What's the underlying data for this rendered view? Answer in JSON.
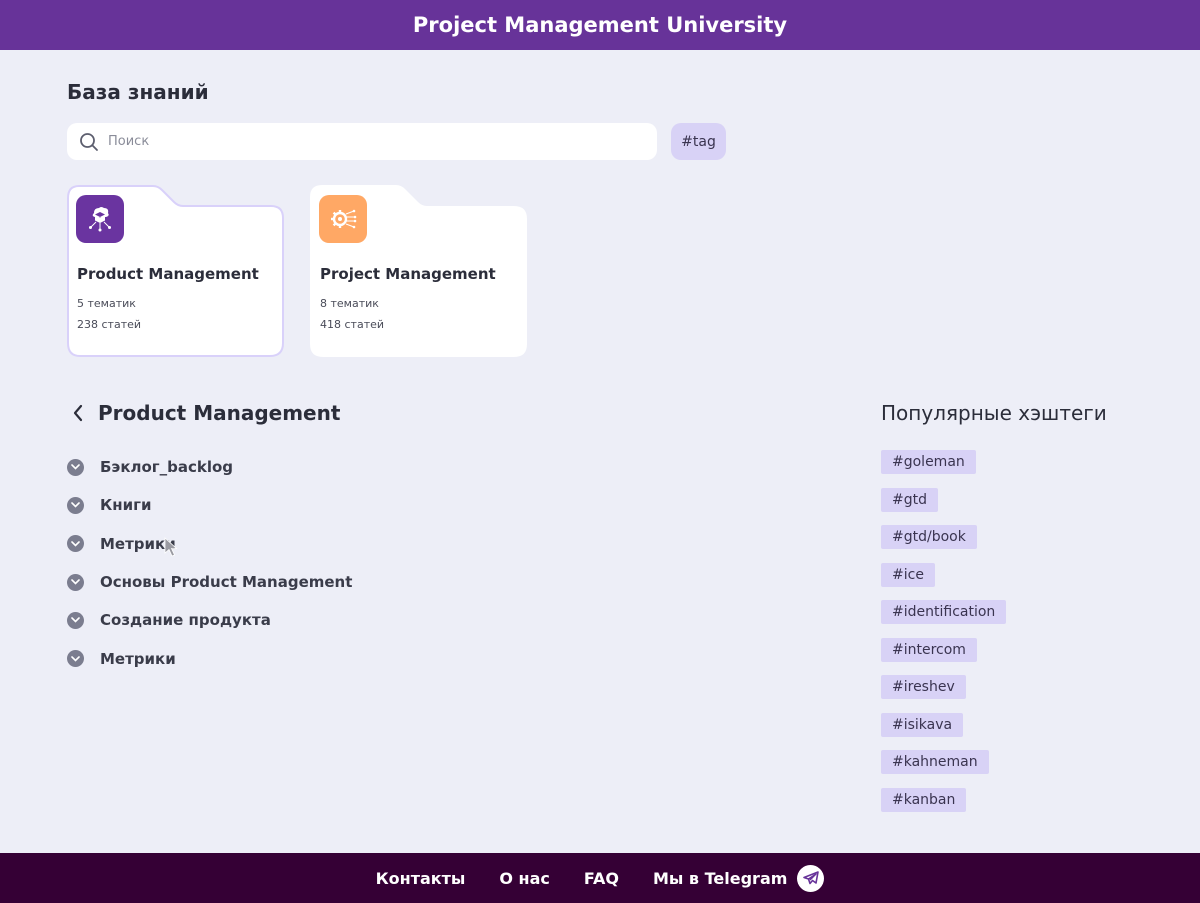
{
  "header": {
    "title": "Project Management University"
  },
  "knowledge_base": {
    "title": "База знаний",
    "search": {
      "placeholder": "Поиск",
      "value": ""
    },
    "tag_button": "#tag"
  },
  "folders": [
    {
      "name": "Product Management",
      "topics": "5 тематик",
      "articles": "238 статей",
      "icon": "cube-network-icon",
      "icon_color": "#6a34a0",
      "selected": true
    },
    {
      "name": "Project Management",
      "topics": "8 тематик",
      "articles": "418 статей",
      "icon": "gear-circuit-icon",
      "icon_color": "#ffa865",
      "selected": false
    }
  ],
  "section": {
    "title": "Product Management",
    "topics": [
      "Бэклог_backlog",
      "Книги",
      "Метрики",
      "Основы Product Management",
      "Создание продукта",
      "Метрики"
    ]
  },
  "popular": {
    "title": "Популярные хэштеги",
    "tags": [
      "#goleman",
      "#gtd",
      "#gtd/book",
      "#ice",
      "#identification",
      "#intercom",
      "#ireshev",
      "#isikava",
      "#kahneman",
      "#kanban"
    ]
  },
  "footer": {
    "links": [
      "Контакты",
      "О нас",
      "FAQ",
      "Мы в Telegram"
    ]
  },
  "colors": {
    "header_bg": "#673399",
    "footer_bg": "#350035",
    "page_bg": "#edeef7",
    "tag_bg": "#d8d2f6",
    "accent": "#673399"
  }
}
